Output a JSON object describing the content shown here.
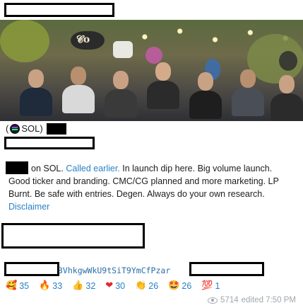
{
  "post": {
    "ticker_prefix": "(",
    "ticker_symbol": "SOL)",
    "body_start": "on SOL. ",
    "link_called": "Called earlier.",
    "body_rest": " In launch dip here. Big volume launch. Good ticker and branding. CMC/CG planned and more marketing. LP Burnt. Be safe with entries. Degen. Always do your own research.",
    "disclaimer": "Disclaimer",
    "contract_fragment": "3VhkgwWkU9tSiT9YmCfPzar"
  },
  "reactions": [
    {
      "icon": "heart-face-icon",
      "glyph": "🥰",
      "count": "35"
    },
    {
      "icon": "fire-icon",
      "glyph": "🔥",
      "count": "33"
    },
    {
      "icon": "thumbs-up-icon",
      "glyph": "👍",
      "count": "32"
    },
    {
      "icon": "heart-icon",
      "glyph": "❤",
      "count": "30"
    },
    {
      "icon": "clap-icon",
      "glyph": "👏",
      "count": "26"
    },
    {
      "icon": "star-struck-icon",
      "glyph": "🤩",
      "count": "26"
    },
    {
      "icon": "hundred-icon",
      "glyph": "💯",
      "count": "1"
    }
  ],
  "meta": {
    "views": "5714",
    "edited": "edited 7:50 PM"
  }
}
